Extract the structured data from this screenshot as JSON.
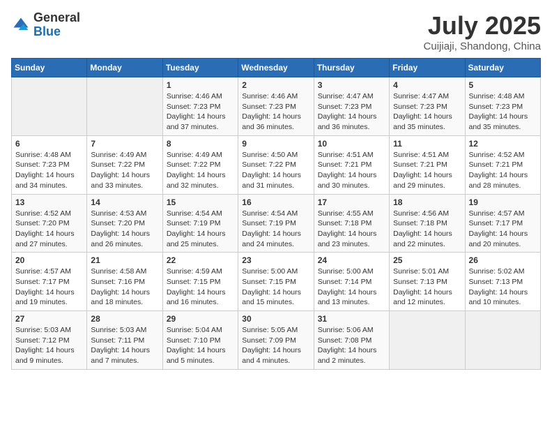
{
  "header": {
    "logo_general": "General",
    "logo_blue": "Blue",
    "month_title": "July 2025",
    "location": "Cuijiaji, Shandong, China"
  },
  "weekdays": [
    "Sunday",
    "Monday",
    "Tuesday",
    "Wednesday",
    "Thursday",
    "Friday",
    "Saturday"
  ],
  "weeks": [
    [
      {
        "day": "",
        "sunrise": "",
        "sunset": "",
        "daylight": ""
      },
      {
        "day": "",
        "sunrise": "",
        "sunset": "",
        "daylight": ""
      },
      {
        "day": "1",
        "sunrise": "Sunrise: 4:46 AM",
        "sunset": "Sunset: 7:23 PM",
        "daylight": "Daylight: 14 hours and 37 minutes."
      },
      {
        "day": "2",
        "sunrise": "Sunrise: 4:46 AM",
        "sunset": "Sunset: 7:23 PM",
        "daylight": "Daylight: 14 hours and 36 minutes."
      },
      {
        "day": "3",
        "sunrise": "Sunrise: 4:47 AM",
        "sunset": "Sunset: 7:23 PM",
        "daylight": "Daylight: 14 hours and 36 minutes."
      },
      {
        "day": "4",
        "sunrise": "Sunrise: 4:47 AM",
        "sunset": "Sunset: 7:23 PM",
        "daylight": "Daylight: 14 hours and 35 minutes."
      },
      {
        "day": "5",
        "sunrise": "Sunrise: 4:48 AM",
        "sunset": "Sunset: 7:23 PM",
        "daylight": "Daylight: 14 hours and 35 minutes."
      }
    ],
    [
      {
        "day": "6",
        "sunrise": "Sunrise: 4:48 AM",
        "sunset": "Sunset: 7:23 PM",
        "daylight": "Daylight: 14 hours and 34 minutes."
      },
      {
        "day": "7",
        "sunrise": "Sunrise: 4:49 AM",
        "sunset": "Sunset: 7:22 PM",
        "daylight": "Daylight: 14 hours and 33 minutes."
      },
      {
        "day": "8",
        "sunrise": "Sunrise: 4:49 AM",
        "sunset": "Sunset: 7:22 PM",
        "daylight": "Daylight: 14 hours and 32 minutes."
      },
      {
        "day": "9",
        "sunrise": "Sunrise: 4:50 AM",
        "sunset": "Sunset: 7:22 PM",
        "daylight": "Daylight: 14 hours and 31 minutes."
      },
      {
        "day": "10",
        "sunrise": "Sunrise: 4:51 AM",
        "sunset": "Sunset: 7:21 PM",
        "daylight": "Daylight: 14 hours and 30 minutes."
      },
      {
        "day": "11",
        "sunrise": "Sunrise: 4:51 AM",
        "sunset": "Sunset: 7:21 PM",
        "daylight": "Daylight: 14 hours and 29 minutes."
      },
      {
        "day": "12",
        "sunrise": "Sunrise: 4:52 AM",
        "sunset": "Sunset: 7:21 PM",
        "daylight": "Daylight: 14 hours and 28 minutes."
      }
    ],
    [
      {
        "day": "13",
        "sunrise": "Sunrise: 4:52 AM",
        "sunset": "Sunset: 7:20 PM",
        "daylight": "Daylight: 14 hours and 27 minutes."
      },
      {
        "day": "14",
        "sunrise": "Sunrise: 4:53 AM",
        "sunset": "Sunset: 7:20 PM",
        "daylight": "Daylight: 14 hours and 26 minutes."
      },
      {
        "day": "15",
        "sunrise": "Sunrise: 4:54 AM",
        "sunset": "Sunset: 7:19 PM",
        "daylight": "Daylight: 14 hours and 25 minutes."
      },
      {
        "day": "16",
        "sunrise": "Sunrise: 4:54 AM",
        "sunset": "Sunset: 7:19 PM",
        "daylight": "Daylight: 14 hours and 24 minutes."
      },
      {
        "day": "17",
        "sunrise": "Sunrise: 4:55 AM",
        "sunset": "Sunset: 7:18 PM",
        "daylight": "Daylight: 14 hours and 23 minutes."
      },
      {
        "day": "18",
        "sunrise": "Sunrise: 4:56 AM",
        "sunset": "Sunset: 7:18 PM",
        "daylight": "Daylight: 14 hours and 22 minutes."
      },
      {
        "day": "19",
        "sunrise": "Sunrise: 4:57 AM",
        "sunset": "Sunset: 7:17 PM",
        "daylight": "Daylight: 14 hours and 20 minutes."
      }
    ],
    [
      {
        "day": "20",
        "sunrise": "Sunrise: 4:57 AM",
        "sunset": "Sunset: 7:17 PM",
        "daylight": "Daylight: 14 hours and 19 minutes."
      },
      {
        "day": "21",
        "sunrise": "Sunrise: 4:58 AM",
        "sunset": "Sunset: 7:16 PM",
        "daylight": "Daylight: 14 hours and 18 minutes."
      },
      {
        "day": "22",
        "sunrise": "Sunrise: 4:59 AM",
        "sunset": "Sunset: 7:15 PM",
        "daylight": "Daylight: 14 hours and 16 minutes."
      },
      {
        "day": "23",
        "sunrise": "Sunrise: 5:00 AM",
        "sunset": "Sunset: 7:15 PM",
        "daylight": "Daylight: 14 hours and 15 minutes."
      },
      {
        "day": "24",
        "sunrise": "Sunrise: 5:00 AM",
        "sunset": "Sunset: 7:14 PM",
        "daylight": "Daylight: 14 hours and 13 minutes."
      },
      {
        "day": "25",
        "sunrise": "Sunrise: 5:01 AM",
        "sunset": "Sunset: 7:13 PM",
        "daylight": "Daylight: 14 hours and 12 minutes."
      },
      {
        "day": "26",
        "sunrise": "Sunrise: 5:02 AM",
        "sunset": "Sunset: 7:13 PM",
        "daylight": "Daylight: 14 hours and 10 minutes."
      }
    ],
    [
      {
        "day": "27",
        "sunrise": "Sunrise: 5:03 AM",
        "sunset": "Sunset: 7:12 PM",
        "daylight": "Daylight: 14 hours and 9 minutes."
      },
      {
        "day": "28",
        "sunrise": "Sunrise: 5:03 AM",
        "sunset": "Sunset: 7:11 PM",
        "daylight": "Daylight: 14 hours and 7 minutes."
      },
      {
        "day": "29",
        "sunrise": "Sunrise: 5:04 AM",
        "sunset": "Sunset: 7:10 PM",
        "daylight": "Daylight: 14 hours and 5 minutes."
      },
      {
        "day": "30",
        "sunrise": "Sunrise: 5:05 AM",
        "sunset": "Sunset: 7:09 PM",
        "daylight": "Daylight: 14 hours and 4 minutes."
      },
      {
        "day": "31",
        "sunrise": "Sunrise: 5:06 AM",
        "sunset": "Sunset: 7:08 PM",
        "daylight": "Daylight: 14 hours and 2 minutes."
      },
      {
        "day": "",
        "sunrise": "",
        "sunset": "",
        "daylight": ""
      },
      {
        "day": "",
        "sunrise": "",
        "sunset": "",
        "daylight": ""
      }
    ]
  ]
}
